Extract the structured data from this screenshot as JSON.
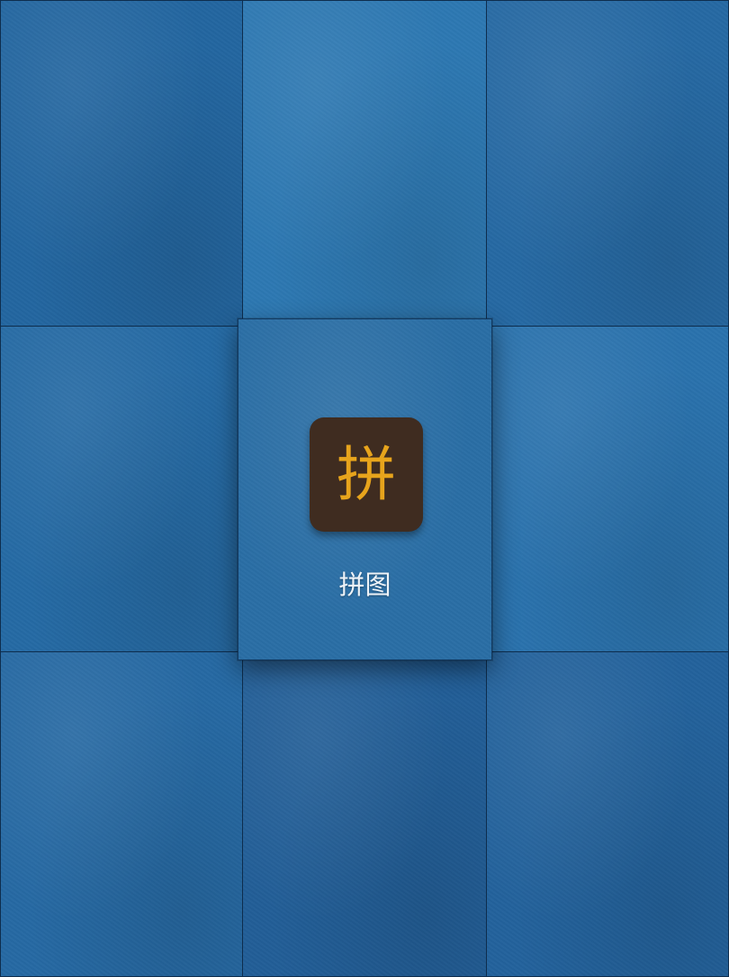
{
  "launcher": {
    "background_tiles": [
      {
        "name": "tile-top-left",
        "color": "#2366a0"
      },
      {
        "name": "tile-top-center",
        "color": "#2d78b2"
      },
      {
        "name": "tile-top-right",
        "color": "#2669a3"
      },
      {
        "name": "tile-middle-left",
        "color": "#256aa4"
      },
      {
        "name": "tile-middle-right",
        "color": "#2a72ad"
      },
      {
        "name": "tile-bottom-left",
        "color": "#2669a3"
      },
      {
        "name": "tile-bottom-center",
        "color": "#225e97"
      },
      {
        "name": "tile-bottom-right",
        "color": "#23629c"
      }
    ],
    "app": {
      "icon_glyph": "拼",
      "label": "拼图",
      "icon_bg_color": "#3f2c20",
      "icon_glyph_color": "#e7a41c"
    }
  }
}
